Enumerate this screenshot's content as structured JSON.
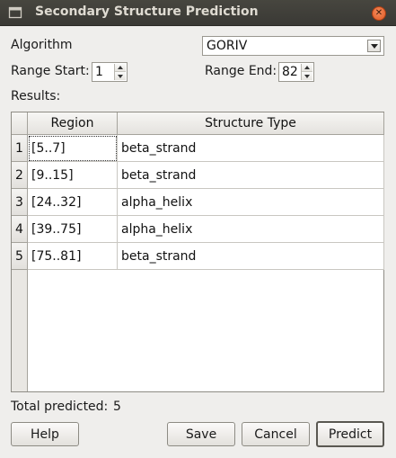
{
  "window": {
    "title": "Secondary Structure Prediction",
    "close_icon": "close-icon",
    "app_icon": "dialog-icon"
  },
  "algorithm": {
    "label": "Algorithm",
    "selected": "GORIV"
  },
  "range": {
    "start_label": "Range Start:",
    "start_value": "1",
    "end_label": "Range End:",
    "end_value": "82"
  },
  "results": {
    "label": "Results:",
    "columns": [
      "Region",
      "Structure Type"
    ],
    "rows": [
      {
        "num": "1",
        "region": "[5..7]",
        "type": "beta_strand"
      },
      {
        "num": "2",
        "region": "[9..15]",
        "type": "beta_strand"
      },
      {
        "num": "3",
        "region": "[24..32]",
        "type": "alpha_helix"
      },
      {
        "num": "4",
        "region": "[39..75]",
        "type": "alpha_helix"
      },
      {
        "num": "5",
        "region": "[75..81]",
        "type": "beta_strand"
      }
    ]
  },
  "total": {
    "label": "Total predicted:",
    "value": "5"
  },
  "buttons": {
    "help": "Help",
    "save": "Save",
    "cancel": "Cancel",
    "predict": "Predict"
  },
  "colors": {
    "titlebar": "#3a3935",
    "close_button": "#e05a24",
    "background": "#efeeec"
  }
}
